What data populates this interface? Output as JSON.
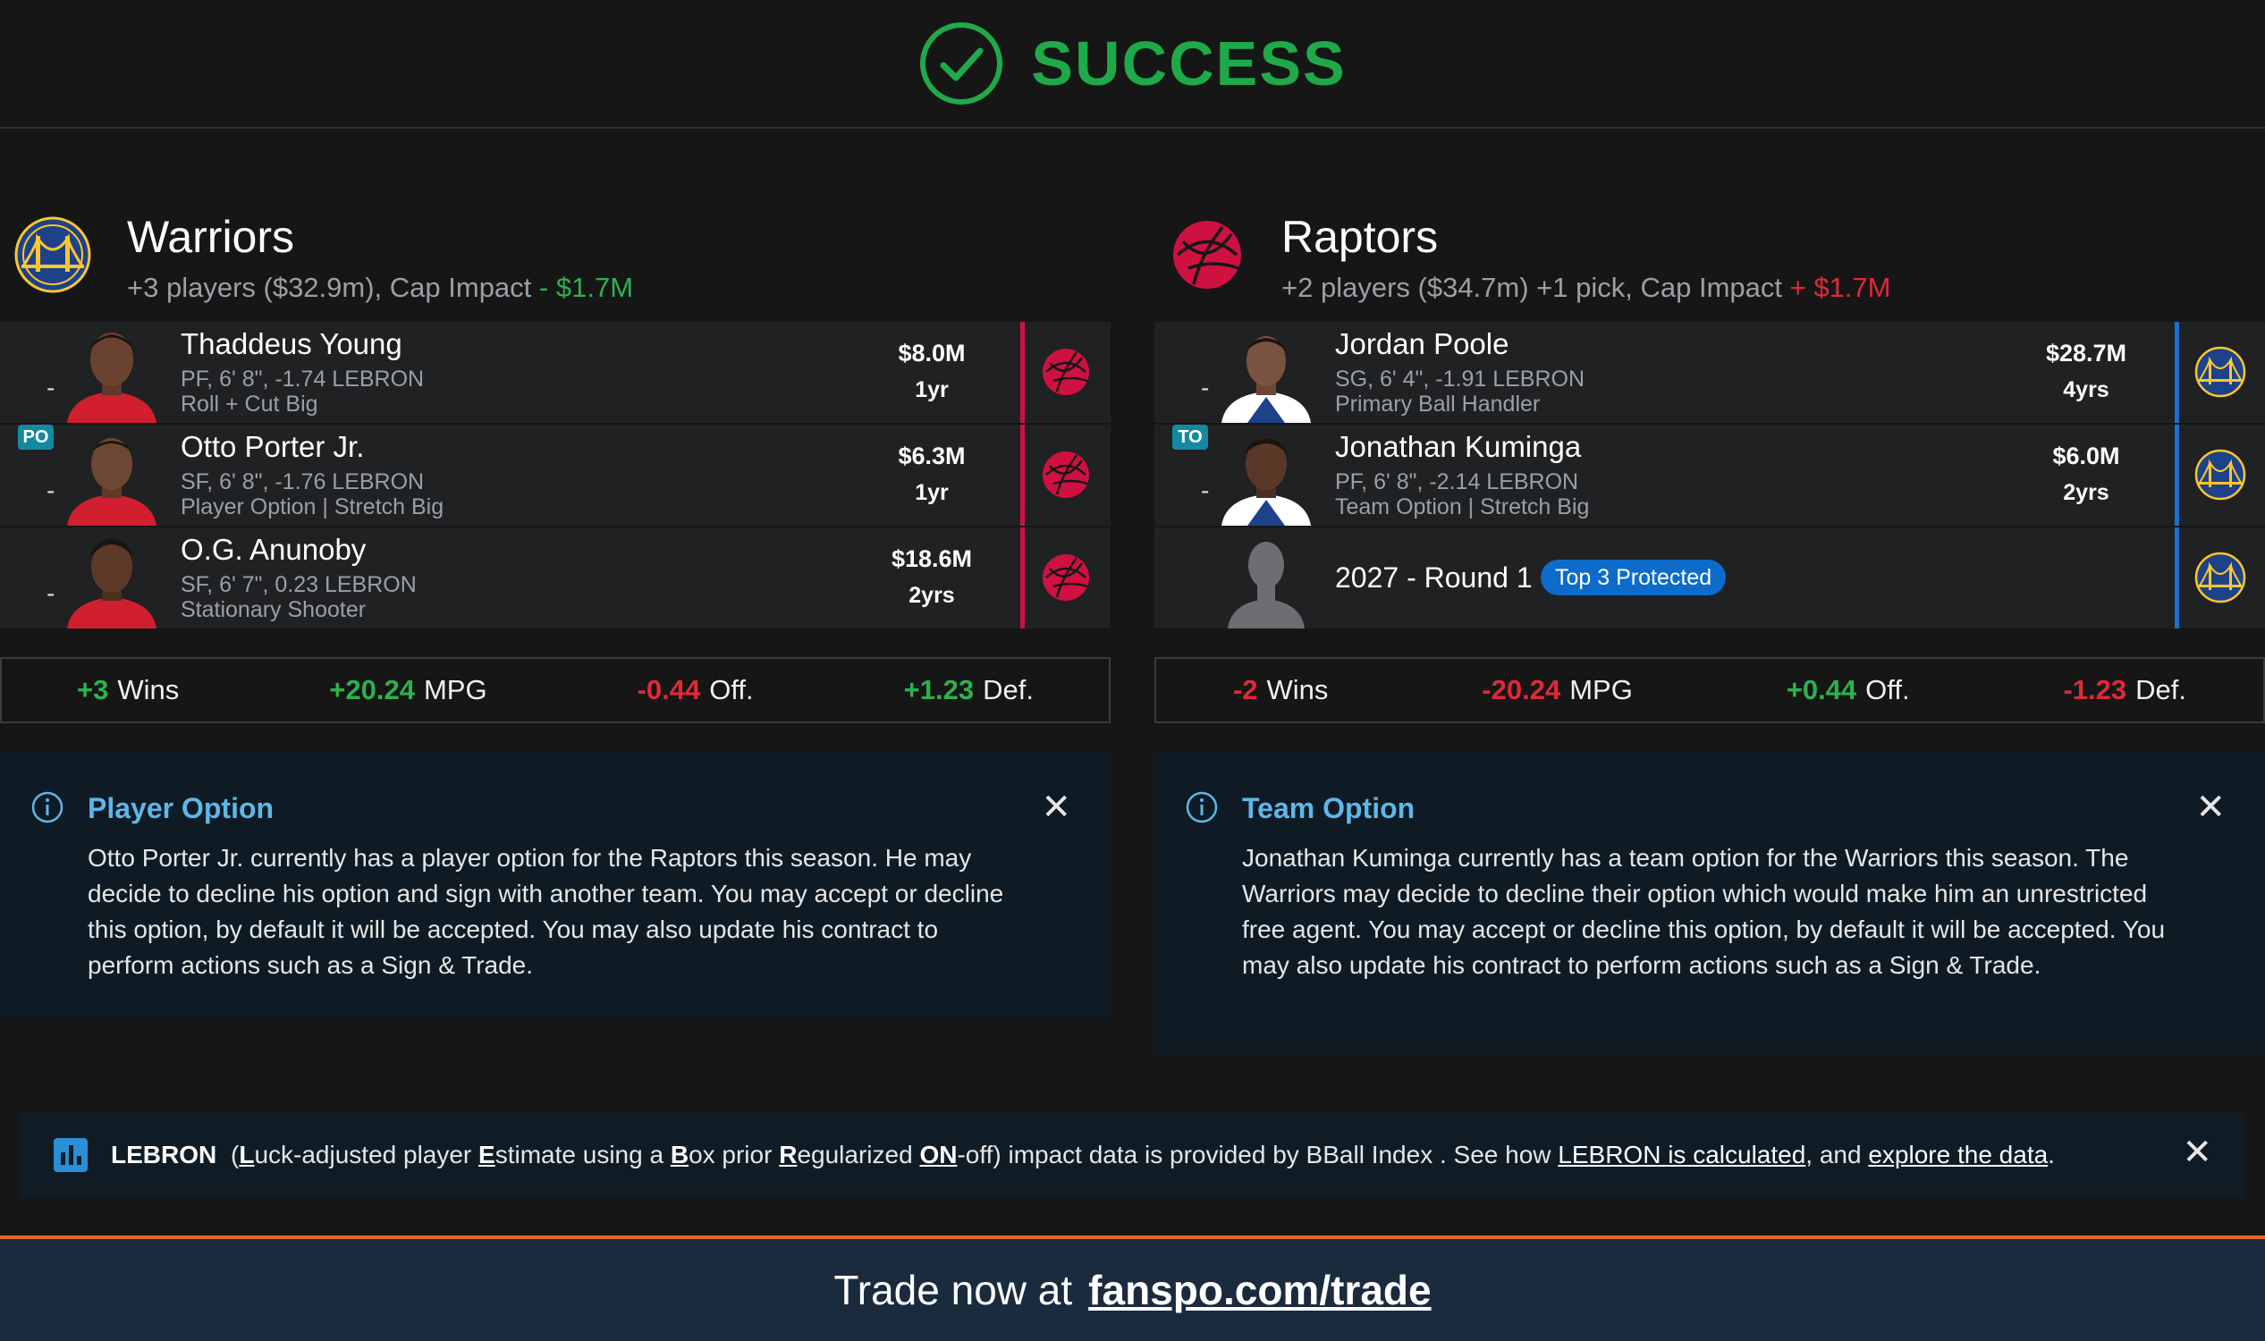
{
  "header": {
    "status": "SUCCESS"
  },
  "teams": [
    {
      "name": "Warriors",
      "summary_prefix": "+3 players ($32.9m), Cap Impact",
      "cap_impact": "- $1.7M",
      "players": [
        {
          "name": "Thaddeus Young",
          "meta": "PF, 6' 8\", -1.74 LEBRON",
          "role": "Roll + Cut Big",
          "salary": "$8.0M",
          "years": "1yr",
          "dash": "-"
        },
        {
          "name": "Otto Porter Jr.",
          "meta": "SF, 6' 8\", -1.76 LEBRON",
          "role": "Player Option | Stretch Big",
          "salary": "$6.3M",
          "years": "1yr",
          "dash": "-",
          "badge": "PO"
        },
        {
          "name": "O.G. Anunoby",
          "meta": "SF, 6' 7\", 0.23 LEBRON",
          "role": "Stationary Shooter",
          "salary": "$18.6M",
          "years": "2yrs",
          "dash": "-"
        }
      ],
      "stats": [
        {
          "value": "+3",
          "label": "Wins"
        },
        {
          "value": "+20.24",
          "label": "MPG"
        },
        {
          "value": "-0.44",
          "label": "Off."
        },
        {
          "value": "+1.23",
          "label": "Def."
        }
      ],
      "info": {
        "title": "Player Option",
        "body": "Otto Porter Jr. currently has a player option for the Raptors this season. He may decide to decline his option and sign with another team. You may accept or decline this option, by default it will be accepted. You may also update his contract to perform actions such as a Sign & Trade.",
        "close": "✕"
      }
    },
    {
      "name": "Raptors",
      "summary_prefix": "+2 players ($34.7m) +1 pick, Cap Impact",
      "cap_impact": "+ $1.7M",
      "players": [
        {
          "name": "Jordan Poole",
          "meta": "SG, 6' 4\", -1.91 LEBRON",
          "role": "Primary Ball Handler",
          "salary": "$28.7M",
          "years": "4yrs",
          "dash": "-"
        },
        {
          "name": "Jonathan Kuminga",
          "meta": "PF, 6' 8\", -2.14 LEBRON",
          "role": "Team Option | Stretch Big",
          "salary": "$6.0M",
          "years": "2yrs",
          "dash": "-",
          "badge": "TO"
        }
      ],
      "pick": {
        "name": "2027 - Round 1",
        "protection": "Top 3 Protected"
      },
      "stats": [
        {
          "value": "-2",
          "label": "Wins"
        },
        {
          "value": "-20.24",
          "label": "MPG"
        },
        {
          "value": "+0.44",
          "label": "Off."
        },
        {
          "value": "-1.23",
          "label": "Def."
        }
      ],
      "info": {
        "title": "Team Option",
        "body": "Jonathan Kuminga currently has a team option for the Warriors this season. The Warriors may decide to decline their option which would make him an unrestricted free agent. You may accept or decline this option, by default it will be accepted. You may also update his contract to perform actions such as a Sign & Trade.",
        "close": "✕"
      }
    }
  ],
  "lebron_banner": {
    "title": "LEBRON",
    "part1": "(",
    "L": "L",
    "t1": "uck-adjusted player ",
    "E": "E",
    "t2": "stimate using a ",
    "B": "B",
    "t3": "ox prior ",
    "R": "R",
    "t4": "egularized ",
    "ON": "ON",
    "t5": "-off) impact data is provided by BBall Index . See how ",
    "link1": "LEBRON is calculated",
    "t6": ", and ",
    "link2": "explore the data",
    "t7": ".",
    "close": "✕"
  },
  "footer": {
    "prefix": "Trade now at",
    "link": "fanspo.com/trade"
  },
  "colors": {
    "warriors": "#1d428a",
    "raptors": "#ce1141",
    "success": "#1faa4a",
    "positive": "#2fb14d",
    "negative": "#e02a36"
  }
}
